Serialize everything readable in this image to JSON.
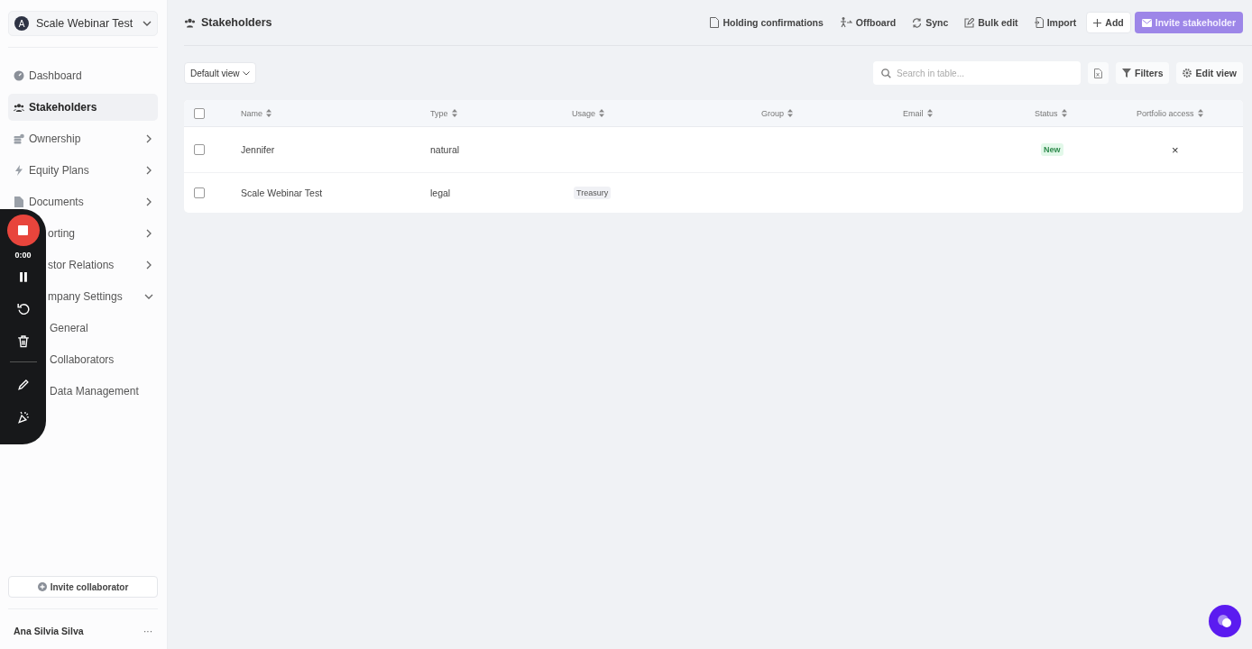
{
  "workspace": {
    "avatar": "A",
    "name": "Scale Webinar Test"
  },
  "sidebar": {
    "items": [
      {
        "label": "Dashboard",
        "selected": false
      },
      {
        "label": "Stakeholders",
        "selected": true
      },
      {
        "label": "Ownership",
        "selected": false,
        "expanded": false
      },
      {
        "label": "Equity Plans",
        "selected": false,
        "expanded": false
      },
      {
        "label": "Documents",
        "selected": false,
        "expanded": false
      },
      {
        "label": "orting",
        "selected": false,
        "expanded": false
      },
      {
        "label": "stor Relations",
        "selected": false,
        "expanded": false
      },
      {
        "label": "mpany Settings",
        "selected": false,
        "expanded": true,
        "children": [
          {
            "label": "General",
            "selected": false
          },
          {
            "label": "Collaborators",
            "selected": false
          },
          {
            "label": "Data Management",
            "selected": false
          }
        ]
      }
    ]
  },
  "invite_collaborator": "Invite collaborator",
  "user": {
    "name": "Ana Silvia Silva",
    "menu": "···"
  },
  "recorder": {
    "time": "0:00"
  },
  "page": {
    "title": "Stakeholders"
  },
  "toolbar": [
    {
      "label": "Holding confirmations",
      "kind": "link"
    },
    {
      "label": "Offboard",
      "kind": "link"
    },
    {
      "label": "Sync",
      "kind": "link"
    },
    {
      "label": "Bulk edit",
      "kind": "link"
    },
    {
      "label": "Import",
      "kind": "link"
    },
    {
      "label": "Add",
      "kind": "button"
    },
    {
      "label": "Invite stakeholder",
      "kind": "primary"
    }
  ],
  "view": {
    "label": "Default view"
  },
  "search": {
    "placeholder": "Search in table..."
  },
  "filters": "Filters",
  "edit_view": "Edit view",
  "table": {
    "columns": [
      "Name",
      "Type",
      "Usage",
      "Group",
      "Email",
      "Status",
      "Portfolio access"
    ],
    "rows": [
      {
        "checked": false,
        "name": "Jennifer",
        "type": "natural",
        "status": "New",
        "portfolio_access": "×"
      },
      {
        "checked": false,
        "name": "Scale Webinar Test",
        "type": "legal",
        "usage": "Treasury"
      }
    ],
    "all_checked": false
  }
}
